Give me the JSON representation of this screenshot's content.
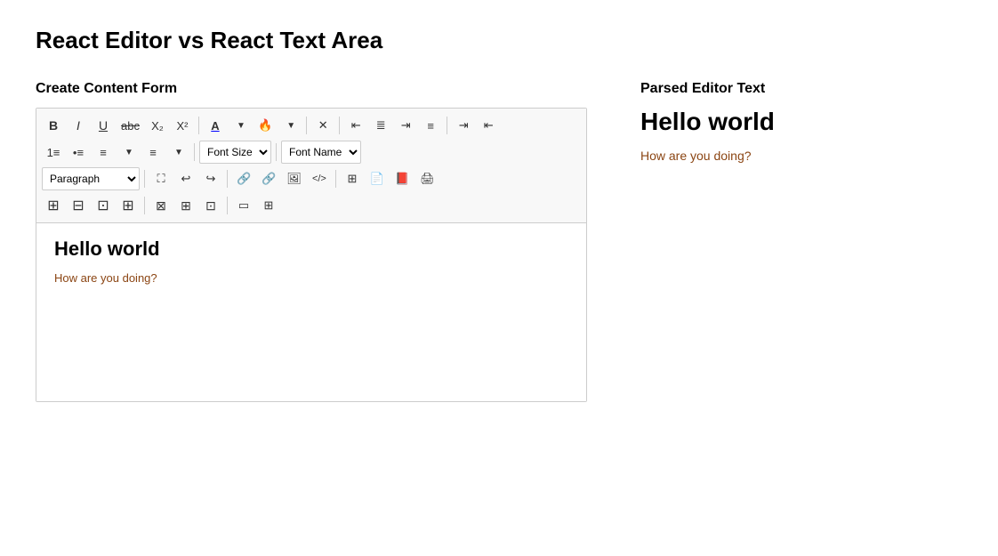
{
  "page": {
    "title": "React Editor vs React Text Area"
  },
  "left": {
    "section_label": "Create Content Form",
    "editor": {
      "heading": "Hello world",
      "paragraph": "How are you doing?"
    },
    "toolbar": {
      "row1": {
        "bold": "B",
        "italic": "I",
        "underline": "U",
        "strikethrough": "abc",
        "subscript": "X₂",
        "superscript": "X²",
        "font_color": "A",
        "highlight_color": "🔥",
        "eraser": "✕",
        "align_left": "≡",
        "align_center": "≡",
        "align_right": "≡",
        "align_justify": "≡",
        "indent_in": "⇥",
        "indent_out": "⇤"
      },
      "row2": {
        "ordered_list1": "1≡",
        "ordered_list2": "•≡",
        "unordered_list1": "≡",
        "unordered_list2": "≡",
        "font_size_placeholder": "Font Size",
        "font_name_placeholder": "Font Name"
      },
      "row3": {
        "paragraph_placeholder": "Paragraph",
        "fullscreen": "⛶",
        "undo": "↩",
        "redo": "↪",
        "link": "🔗",
        "unlink": "🔗",
        "image": "🖼",
        "code": "</>",
        "table": "⊞",
        "file": "📄",
        "pdf": "📕",
        "print": "🖨"
      },
      "row4": {
        "table1": "⊞",
        "table2": "⊞",
        "table3": "⊞",
        "table4": "⊞",
        "merge1": "⊠",
        "merge2": "⊠",
        "merge3": "⊠",
        "cell1": "▭",
        "cell2": "⊞"
      }
    }
  },
  "right": {
    "section_label": "Parsed Editor Text",
    "heading": "Hello world",
    "paragraph": "How are you doing?"
  }
}
